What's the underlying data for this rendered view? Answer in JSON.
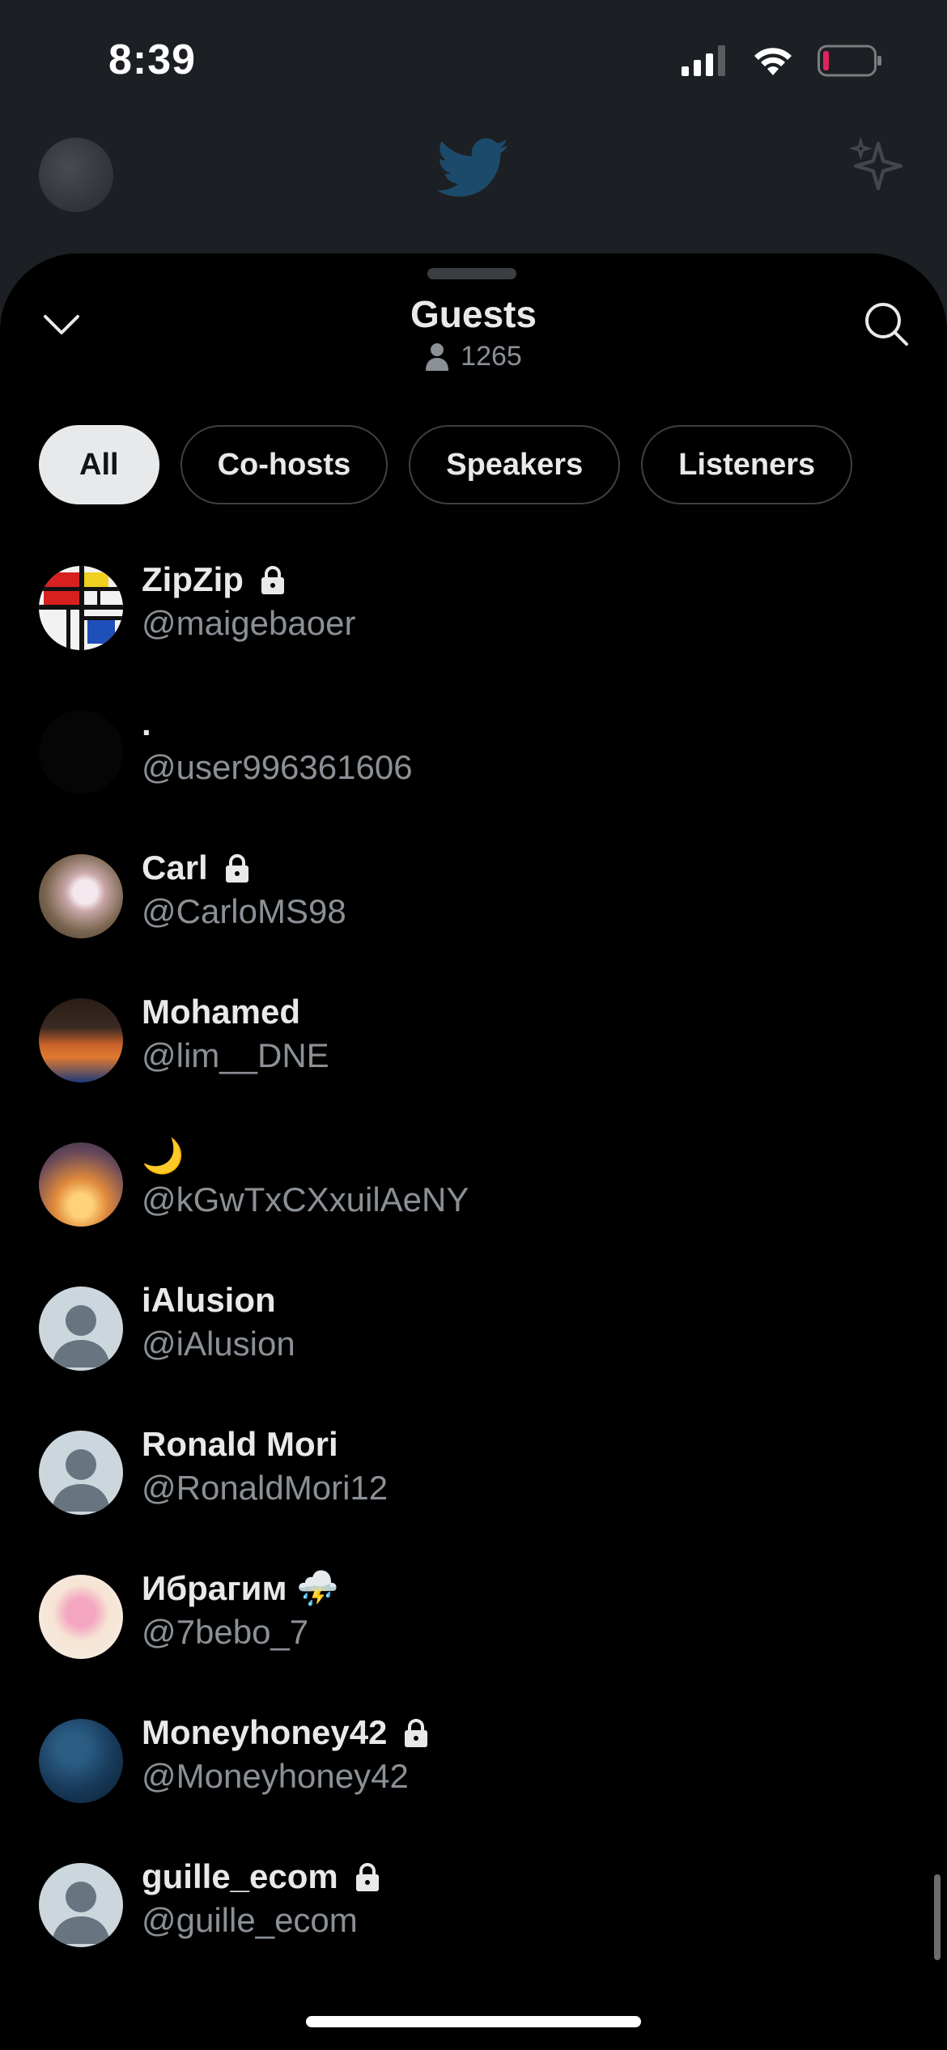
{
  "status_bar": {
    "time": "8:39"
  },
  "sheet": {
    "title": "Guests",
    "count": "1265",
    "tabs": [
      {
        "label": "All",
        "active": true
      },
      {
        "label": "Co-hosts",
        "active": false
      },
      {
        "label": "Speakers",
        "active": false
      },
      {
        "label": "Listeners",
        "active": false
      }
    ]
  },
  "guests": [
    {
      "name": "ZipZip",
      "handle": "@maigebaoer",
      "badge": "lock-icon"
    },
    {
      "name": ".",
      "handle": "@user996361606",
      "badge": ""
    },
    {
      "name": "Carl",
      "handle": "@CarloMS98",
      "badge": "lock-icon"
    },
    {
      "name": "Mohamed",
      "handle": "@lim__DNE",
      "badge": ""
    },
    {
      "name": "🌙",
      "handle": "@kGwTxCXxuilAeNY",
      "badge": ""
    },
    {
      "name": "iAlusion",
      "handle": "@iAlusion",
      "badge": ""
    },
    {
      "name": "Ronald Mori",
      "handle": "@RonaldMori12",
      "badge": ""
    },
    {
      "name": "Ибрагим ⛈️",
      "handle": "@7bebo_7",
      "badge": ""
    },
    {
      "name": "Moneyhoney42",
      "handle": "@Moneyhoney42",
      "badge": "lock-icon"
    },
    {
      "name": "guille_ecom",
      "handle": "@guille_ecom",
      "badge": "lock-icon"
    }
  ],
  "colors": {
    "sheet_bg": "#000000",
    "text_primary": "#e7e9ea",
    "text_secondary": "#8b9096",
    "battery_low": "#e0245e"
  }
}
